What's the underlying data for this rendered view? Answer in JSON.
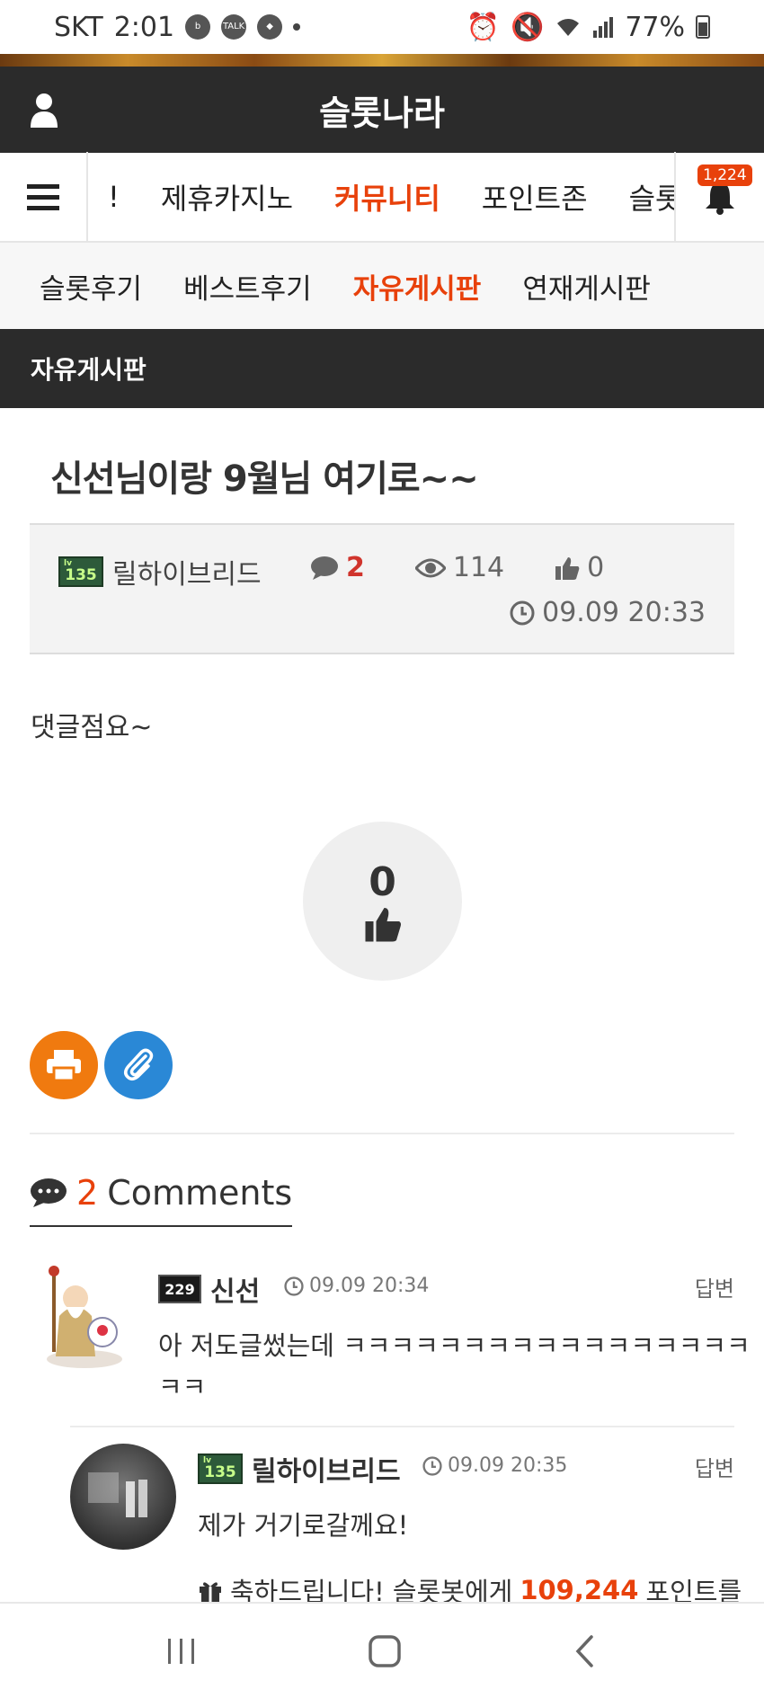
{
  "statusbar": {
    "carrier": "SKT",
    "time": "2:01",
    "battery": "77%"
  },
  "header": {
    "site_title": "슬롯나라"
  },
  "mainnav": {
    "items": [
      "!",
      "제휴카지노",
      "커뮤니티",
      "포인트존",
      "슬롯"
    ],
    "active": "커뮤니티",
    "notification_count": "1,224"
  },
  "subnav": {
    "items": [
      "슬롯후기",
      "베스트후기",
      "자유게시판",
      "연재게시판"
    ],
    "active": "자유게시판"
  },
  "board": {
    "title": "자유게시판"
  },
  "post": {
    "title": "신선님이랑 9월님 여기로~~",
    "author": "릴하이브리드",
    "author_level": "135",
    "comment_count": "2",
    "views": "114",
    "likes": "0",
    "date": "09.09 20:33",
    "body": "댓글점요~",
    "like_button_count": "0"
  },
  "comments_section": {
    "count": "2",
    "label": "Comments"
  },
  "comments": [
    {
      "author": "신선",
      "author_level": "229",
      "time": "09.09 20:34",
      "reply_label": "답변",
      "text_line1": "아 저도글썼는데 ㅋㅋㅋㅋㅋㅋㅋㅋㅋㅋㅋㅋㅋㅋㅋㅋㅋ",
      "text_line2": "ㅋㅋ"
    },
    {
      "author": "릴하이브리드",
      "author_level": "135",
      "time": "09.09 20:35",
      "reply_label": "답변",
      "text": "제가 거기로갈께요!",
      "point_prefix": "축하드립니다! 슬롯봇에게",
      "point_value": "109,244",
      "point_suffix": "포인트를"
    }
  ],
  "colors": {
    "accent": "#e8410b",
    "dark": "#2b2b2b",
    "print_btn": "#f07a0f",
    "link_btn": "#2a88d6"
  }
}
